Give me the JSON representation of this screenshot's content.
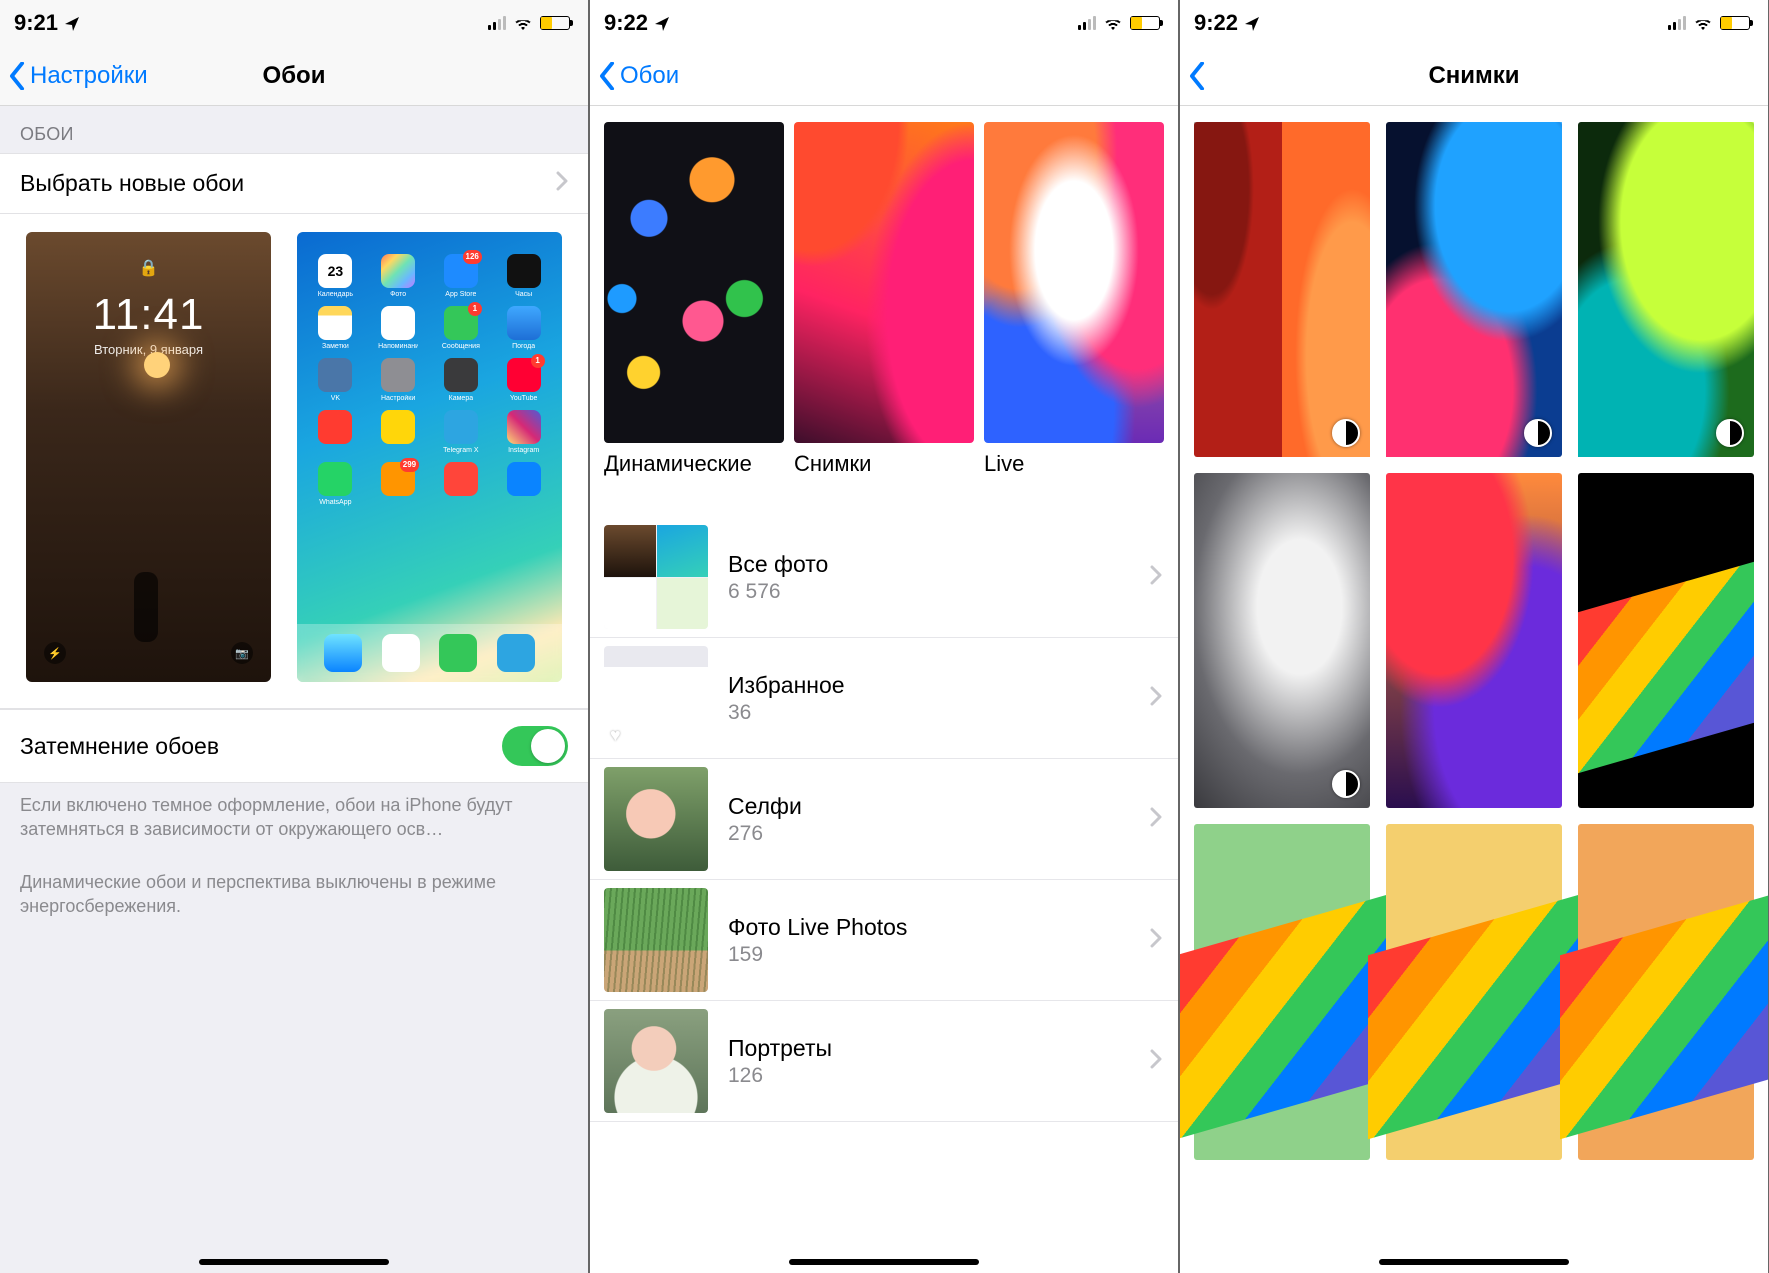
{
  "screen1": {
    "status_time": "9:21",
    "nav_back": "Настройки",
    "nav_title": "Обои",
    "group_header": "ОБОИ",
    "choose_row": "Выбрать новые обои",
    "dim_row": "Затемнение обоев",
    "dim_on": true,
    "footer1": "Если включено темное оформление, обои на iPhone будут затемняться в зависимости от окружающего осв…",
    "footer2": "Динамические обои и перспектива выключены в режиме энергосбережения.",
    "lockscreen": {
      "time": "11:41",
      "date": "Вторник, 9 января"
    },
    "home_apps": [
      {
        "label": "Календарь",
        "bg": "#ffffff",
        "badge": null,
        "day": "23"
      },
      {
        "label": "Фото",
        "bg": "linear-gradient(135deg,#ff7a59,#ffd861,#6fe3b5,#6ab8ff,#c07aff)",
        "badge": null
      },
      {
        "label": "App Store",
        "bg": "#1e8bff",
        "badge": "126"
      },
      {
        "label": "Часы",
        "bg": "#111",
        "badge": null
      },
      {
        "label": "Заметки",
        "bg": "linear-gradient(180deg,#ffd75a 0 28%, #fff 28%)",
        "badge": null
      },
      {
        "label": "Напоминания",
        "bg": "#fff",
        "badge": null
      },
      {
        "label": "Сообщения",
        "bg": "#34c759",
        "badge": "1"
      },
      {
        "label": "Погода",
        "bg": "linear-gradient(180deg,#3fa8ff,#1e6fd6)",
        "badge": null
      },
      {
        "label": "VK",
        "bg": "#4a76a8",
        "badge": null
      },
      {
        "label": "Настройки",
        "bg": "#8e8e93",
        "badge": null
      },
      {
        "label": "Камера",
        "bg": "#3a3a3c",
        "badge": null
      },
      {
        "label": "YouTube",
        "bg": "#ff0033",
        "badge": "1"
      },
      {
        "label": "",
        "bg": "#ff3b30",
        "badge": null
      },
      {
        "label": "",
        "bg": "#ffd60a",
        "badge": null
      },
      {
        "label": "Telegram X",
        "bg": "#2da5e1",
        "badge": null
      },
      {
        "label": "Instagram",
        "bg": "linear-gradient(45deg,#feda75,#d62976,#4f5bd5)",
        "badge": null
      },
      {
        "label": "WhatsApp",
        "bg": "#25d366",
        "badge": null
      },
      {
        "label": "",
        "bg": "#ff9500",
        "badge": "299"
      },
      {
        "label": "",
        "bg": "#ff453a",
        "badge": null
      },
      {
        "label": "",
        "bg": "#0a84ff",
        "badge": null
      }
    ],
    "dock": [
      {
        "bg": "linear-gradient(180deg,#6fe3ff,#0a84ff)"
      },
      {
        "bg": "#ffffff"
      },
      {
        "bg": "#34c759"
      },
      {
        "bg": "#2da5e1"
      }
    ]
  },
  "screen2": {
    "status_time": "9:22",
    "nav_back": "Обои",
    "categories": [
      {
        "label": "Динамические"
      },
      {
        "label": "Снимки"
      },
      {
        "label": "Live"
      }
    ],
    "albums": [
      {
        "title": "Все фото",
        "count": "6 576",
        "thumb": "allphotos"
      },
      {
        "title": "Избранное",
        "count": "36",
        "thumb": "fav"
      },
      {
        "title": "Селфи",
        "count": "276",
        "thumb": "selfie"
      },
      {
        "title": "Фото Live Photos",
        "count": "159",
        "thumb": "lp"
      },
      {
        "title": "Портреты",
        "count": "126",
        "thumb": "port"
      }
    ]
  },
  "screen3": {
    "status_time": "9:22",
    "nav_title": "Снимки"
  }
}
